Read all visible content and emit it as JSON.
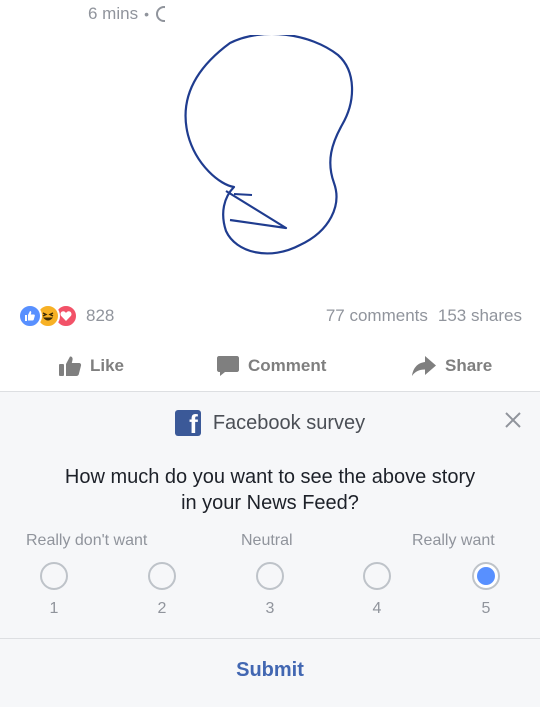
{
  "post": {
    "timestamp": "6 mins",
    "separator": "•",
    "privacy_icon": "globe-icon"
  },
  "stats": {
    "reactions": [
      "like",
      "haha",
      "love"
    ],
    "reaction_count": "828",
    "comments": "77 comments",
    "shares": "153 shares"
  },
  "actions": {
    "like": "Like",
    "comment": "Comment",
    "share": "Share"
  },
  "survey": {
    "title": "Facebook survey",
    "question_line1": "How much do you want to see the above story",
    "question_line2": "in your News Feed?",
    "label_low": "Really don't want",
    "label_mid": "Neutral",
    "label_high": "Really want",
    "options": [
      "1",
      "2",
      "3",
      "4",
      "5"
    ],
    "selected": "5",
    "submit": "Submit"
  },
  "colors": {
    "brand": "#3b5998",
    "accent": "#5890ff",
    "submit": "#4267b2",
    "muted": "#90949c"
  }
}
